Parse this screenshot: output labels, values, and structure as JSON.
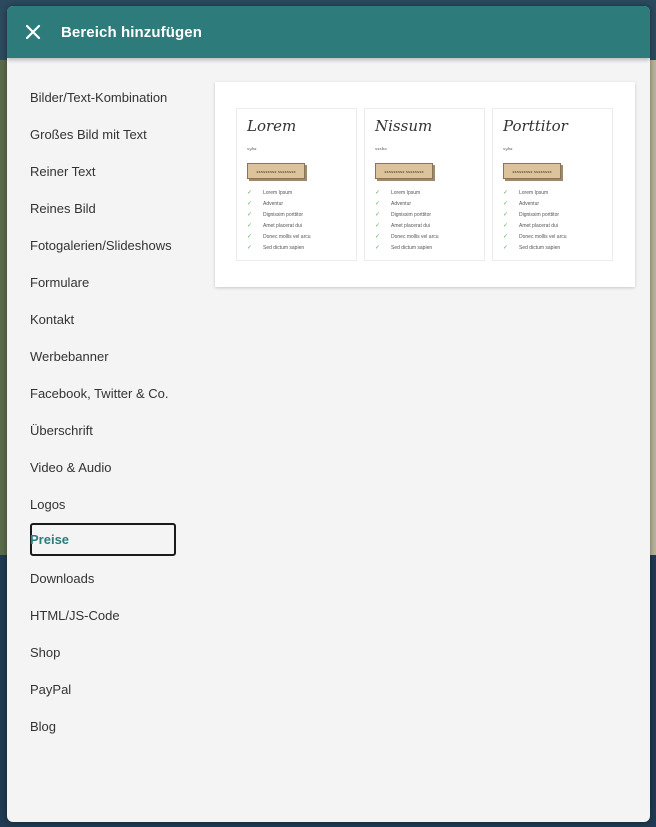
{
  "modal": {
    "title": "Bereich hinzufügen",
    "close_icon": "close-icon",
    "header_color": "#2e7b7b"
  },
  "sidebar": {
    "active_index": 12,
    "items": [
      {
        "label": "Bilder/Text-Kombination"
      },
      {
        "label": "Großes Bild mit Text"
      },
      {
        "label": "Reiner Text"
      },
      {
        "label": "Reines Bild"
      },
      {
        "label": "Fotogalerien/Slideshows"
      },
      {
        "label": "Formulare"
      },
      {
        "label": "Kontakt"
      },
      {
        "label": "Werbebanner"
      },
      {
        "label": "Facebook, Twitter & Co."
      },
      {
        "label": "Überschrift"
      },
      {
        "label": "Video & Audio"
      },
      {
        "label": "Logos"
      },
      {
        "label": "Preise"
      },
      {
        "label": "Downloads"
      },
      {
        "label": "HTML/JS-Code"
      },
      {
        "label": "Shop"
      },
      {
        "label": "PayPal"
      },
      {
        "label": "Blog"
      }
    ]
  },
  "preview": {
    "columns": [
      {
        "name": "Lorem",
        "price": "xyba",
        "button": "xxxxxxxxx xxxxxxxx",
        "features": [
          "Lorem Ipsum",
          "Adventur",
          "Dignissim porttitor",
          "Amet placerat dui",
          "Donec mollis vel arcu",
          "Sed dictum sapien"
        ]
      },
      {
        "name": "Nissum",
        "price": "xxxba",
        "button": "xxxxxxxxx xxxxxxxx",
        "features": [
          "Lorem Ipsum",
          "Adventur",
          "Dignissim porttitor",
          "Amet placerat dui",
          "Donec mollis vel arcu",
          "Sed dictum sapien"
        ]
      },
      {
        "name": "Porttitor",
        "price": "xyba",
        "button": "xxxxxxxxx xxxxxxxx",
        "features": [
          "Lorem Ipsum",
          "Adventur",
          "Dignissim porttitor",
          "Amet placerat dui",
          "Donec mollis vel arcu",
          "Sed dictum sapien"
        ]
      }
    ]
  }
}
